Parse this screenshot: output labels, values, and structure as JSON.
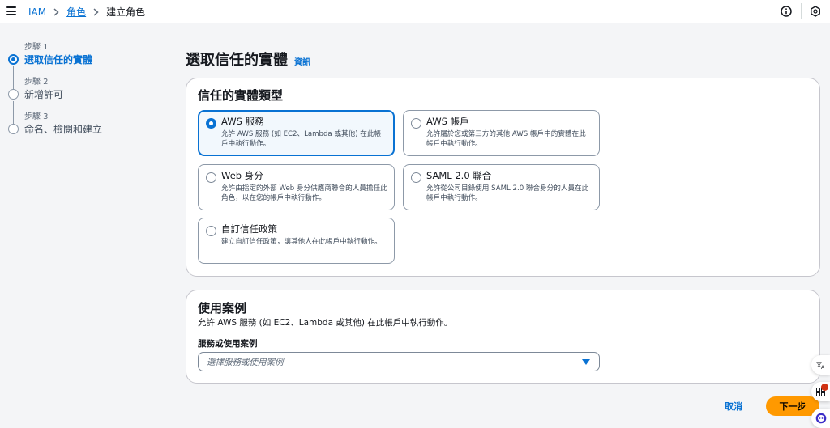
{
  "breadcrumb": {
    "items": [
      "IAM",
      "角色"
    ],
    "current": "建立角色"
  },
  "steps": [
    {
      "caption": "步驟 1",
      "label": "選取信任的實體",
      "active": true
    },
    {
      "caption": "步驟 2",
      "label": "新增許可",
      "active": false
    },
    {
      "caption": "步驟 3",
      "label": "命名、檢閱和建立",
      "active": false
    }
  ],
  "page": {
    "title": "選取信任的實體",
    "info_link": "資訊"
  },
  "entity_card": {
    "title": "信任的實體類型",
    "options": [
      {
        "title": "AWS 服務",
        "desc": "允許 AWS 服務 (如 EC2、Lambda 或其他) 在此帳戶中執行動作。",
        "selected": true
      },
      {
        "title": "AWS 帳戶",
        "desc": "允許屬於您或第三方的其他 AWS 帳戶中的實體在此帳戶中執行動作。",
        "selected": false
      },
      {
        "title": "Web 身分",
        "desc": "允許由指定的外部 Web 身分供應商聯合的人員擔任此角色，以在您的帳戶中執行動作。",
        "selected": false
      },
      {
        "title": "SAML 2.0 聯合",
        "desc": "允許從公司目錄使用 SAML 2.0 聯合身分的人員在此帳戶中執行動作。",
        "selected": false
      },
      {
        "title": "自訂信任政策",
        "desc": "建立自訂信任政策，讓其他人在此帳戶中執行動作。",
        "selected": false
      }
    ]
  },
  "usecase_card": {
    "title": "使用案例",
    "desc": "允許 AWS 服務 (如 EC2、Lambda 或其他) 在此帳戶中執行動作。",
    "field_label": "服務或使用案例",
    "placeholder": "選擇服務或使用案例"
  },
  "actions": {
    "cancel": "取消",
    "next": "下一步"
  },
  "colors": {
    "accent": "#0972d3",
    "primary_button": "#ff9900"
  }
}
